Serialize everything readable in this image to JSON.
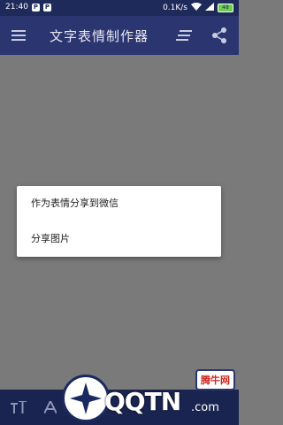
{
  "status": {
    "time": "21:40",
    "p1": "P",
    "p2": "P",
    "speed": "0.1K/s",
    "battery": "48"
  },
  "appbar": {
    "title": "文字表情制作器"
  },
  "dialog": {
    "items": [
      {
        "label": "作为表情分享到微信"
      },
      {
        "label": "分享图片"
      }
    ]
  },
  "watermark": {
    "brand": "QQTN",
    "domain": ".com",
    "badge": "腾牛网"
  },
  "colors": {
    "appbar": "#2b3570",
    "statusbar": "#1e2a59",
    "scrim": "#7a7a7a"
  }
}
